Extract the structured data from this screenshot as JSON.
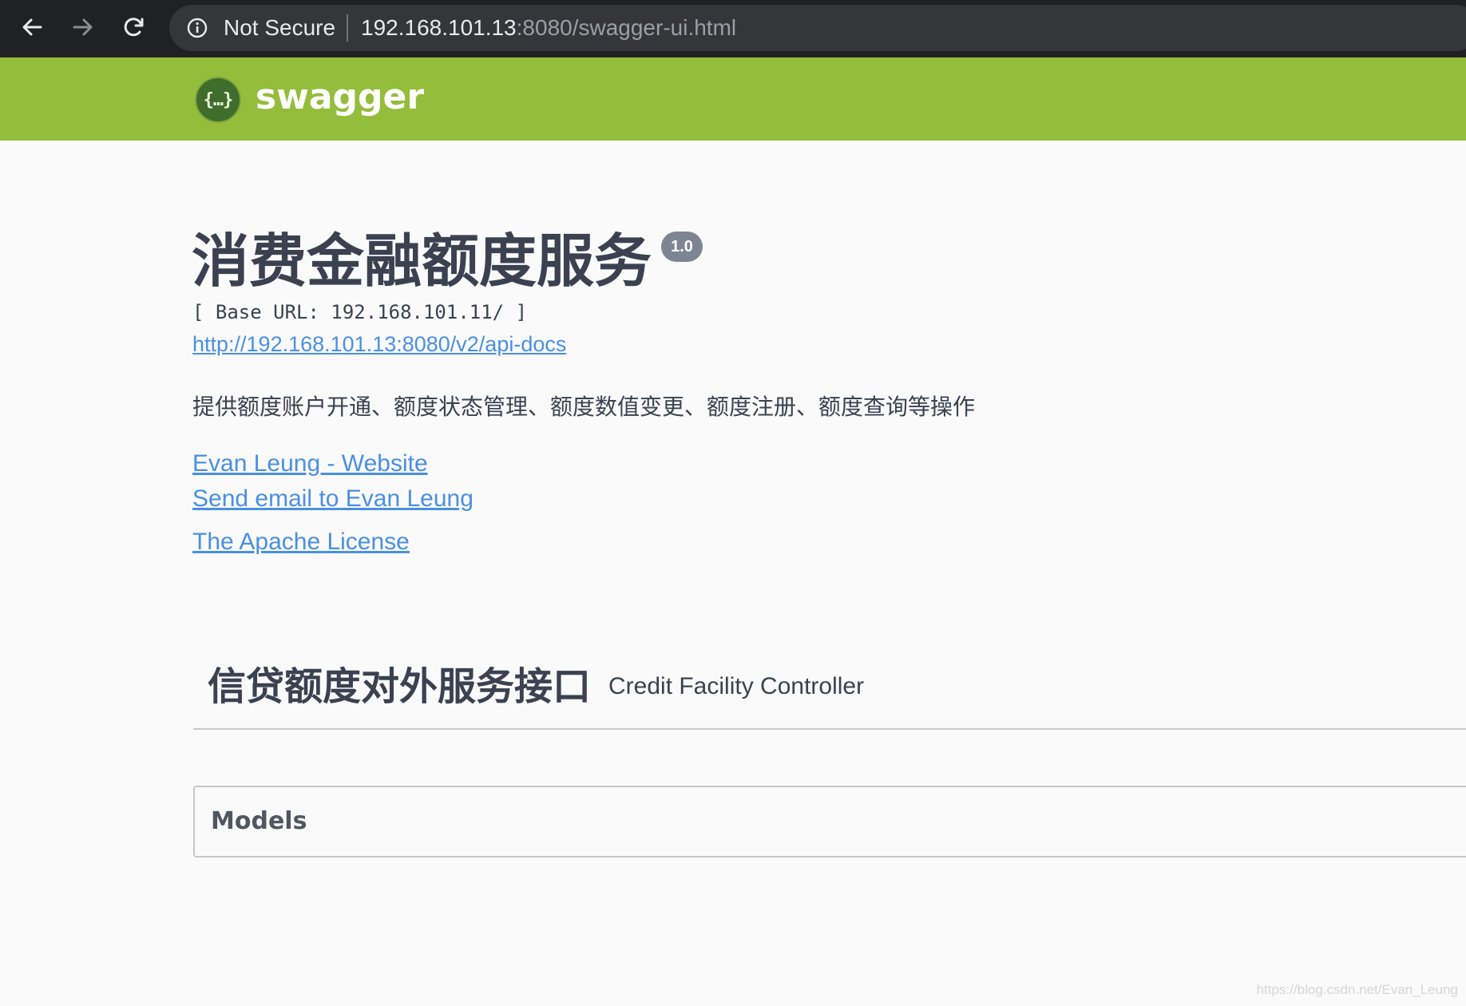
{
  "browser": {
    "security_label": "Not Secure",
    "url_host": "192.168.101.13",
    "url_rest": ":8080/swagger-ui.html"
  },
  "topbar": {
    "logo_glyph": "{…}",
    "logo_text": "swagger"
  },
  "info": {
    "title": "消费金融额度服务",
    "version": "1.0",
    "base_url": "[ Base URL: 192.168.101.11/ ]",
    "spec_url": "http://192.168.101.13:8080/v2/api-docs",
    "description": "提供额度账户开通、额度状态管理、额度数值变更、额度注册、额度查询等操作",
    "contact_website": "Evan Leung - Website",
    "contact_email": "Send email to Evan Leung",
    "license": "The Apache License"
  },
  "tags": [
    {
      "name": "信贷额度对外服务接口",
      "description": "Credit Facility Controller"
    }
  ],
  "models": {
    "title": "Models"
  },
  "watermark": "https://blog.csdn.net/Evan_Leung",
  "colors": {
    "topbar": "#94bd3c",
    "link": "#4990e2",
    "text": "#3b4151"
  },
  "icons": [
    "back-arrow-icon",
    "forward-arrow-icon",
    "reload-icon",
    "info-circle-icon",
    "swagger-logo-icon"
  ]
}
